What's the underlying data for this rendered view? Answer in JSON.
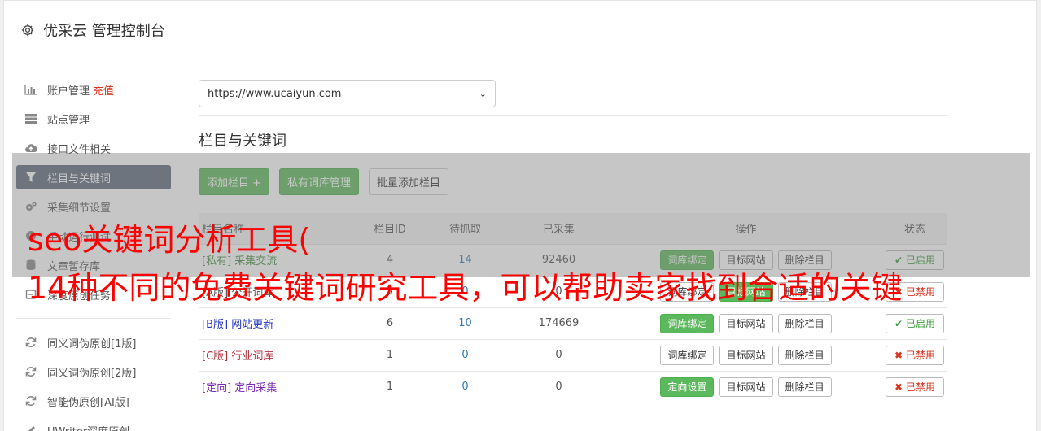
{
  "header": {
    "title": "优采云 管理控制台"
  },
  "sidebar": {
    "items": [
      {
        "label": "账户管理",
        "extra": "充值",
        "icon": "bar-chart-icon"
      },
      {
        "label": "站点管理",
        "icon": "server-icon"
      },
      {
        "label": "接口文件相关",
        "icon": "cloud-upload-icon"
      },
      {
        "label": "栏目与关键词",
        "icon": "filter-icon"
      },
      {
        "label": "采集细节设置",
        "icon": "cogs-icon"
      },
      {
        "label": "手动运行测试",
        "icon": "play-icon"
      },
      {
        "label": "文章暂存库",
        "icon": "database-icon"
      },
      {
        "label": "深度原创任务",
        "icon": "task-icon"
      }
    ],
    "tools": [
      {
        "label": "同义词伪原创[1版]",
        "icon": "refresh-icon"
      },
      {
        "label": "同义词伪原创[2版]",
        "icon": "refresh-icon"
      },
      {
        "label": "智能伪原创[AI版]",
        "icon": "refresh-icon"
      },
      {
        "label": "UWriter深度原创",
        "icon": "edit-icon"
      }
    ]
  },
  "site_select": {
    "value": "https://www.ucaiyun.com"
  },
  "section": {
    "title": "栏目与关键词"
  },
  "actions": {
    "add_column": "添加栏目 +",
    "private_lib": "私有词库管理",
    "batch_add": "批量添加栏目"
  },
  "table": {
    "headers": [
      "栏目名称",
      "栏目ID",
      "待抓取",
      "已采集",
      "操作",
      "状态"
    ],
    "rows": [
      {
        "tag": "[私有]",
        "name": "采集交流",
        "id": "4",
        "pending": "14",
        "collected": "92460",
        "bind": "词库绑定",
        "target": "目标网站",
        "delete": "删除栏目",
        "status": "已启用"
      },
      {
        "tag": "[A版]",
        "name": "公开词库",
        "id": "5",
        "pending": "0",
        "collected": "0",
        "bind": "词库绑定",
        "target": "目标网站",
        "delete": "删除栏目",
        "status": "已禁用"
      },
      {
        "tag": "[B版]",
        "name": "网站更新",
        "id": "6",
        "pending": "10",
        "collected": "174669",
        "bind": "词库绑定",
        "target": "目标网站",
        "delete": "删除栏目",
        "status": "已启用"
      },
      {
        "tag": "[C版]",
        "name": "行业词库",
        "id": "1",
        "pending": "0",
        "collected": "0",
        "bind": "词库绑定",
        "target": "目标网站",
        "delete": "删除栏目",
        "status": "已禁用"
      },
      {
        "tag": "[定向]",
        "name": "定向采集",
        "id": "1",
        "pending": "0",
        "collected": "0",
        "bind": "定向设置",
        "target": "目标网站",
        "delete": "删除栏目",
        "status": "已禁用"
      }
    ]
  },
  "overlay": {
    "line1": "seo关键词分析工具(",
    "line2": "14种不同的免费关键词研究工具，可以帮助卖家找到合适的关键"
  },
  "colors": {
    "accent_green": "#5cb85c",
    "sidebar_active": "#5e6a7a",
    "recharge_red": "#d9331f",
    "overlay_text": "#ff0000"
  }
}
